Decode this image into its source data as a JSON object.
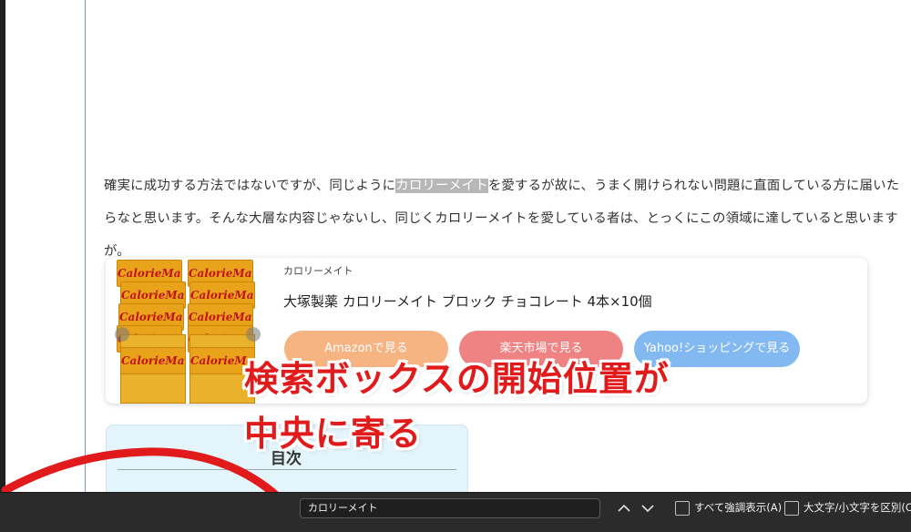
{
  "article": {
    "paragraph_before": "確実に成功する方法ではないですが、同じように",
    "highlight": "カロリーメイト",
    "paragraph_after": "を愛するが故に、うまく開けられない問題に直面している方に届いたらなと思います。そんな大層な内容じゃないし、同じくカロリーメイトを愛している者は、とっくにこの領域に達していると思いますが。"
  },
  "product_card": {
    "brand": "カロリーメイト",
    "name": "大塚製薬 カロリーメイト ブロック チョコレート 4本×10個",
    "package_text": "CalorieMate",
    "buttons": [
      {
        "label": "Amazonで見る",
        "color": "#f39b5a"
      },
      {
        "label": "楽天市場で見る",
        "color": "#ea5a5a"
      },
      {
        "label": "Yahoo!ショッピングで見る",
        "color": "#5aa2ef"
      }
    ]
  },
  "toc": {
    "title": "目次"
  },
  "annotation": {
    "line1": "検索ボックスの開始位置が",
    "line2": "中央に寄る",
    "color": "#e11b1b"
  },
  "findbar": {
    "query": "カロリーメイト",
    "up_icon": "chevron-up-icon",
    "down_icon": "chevron-down-icon",
    "highlight_all_label": "すべて強調表示(A)",
    "match_case_label": "大文字/小文字を区別(C)"
  }
}
